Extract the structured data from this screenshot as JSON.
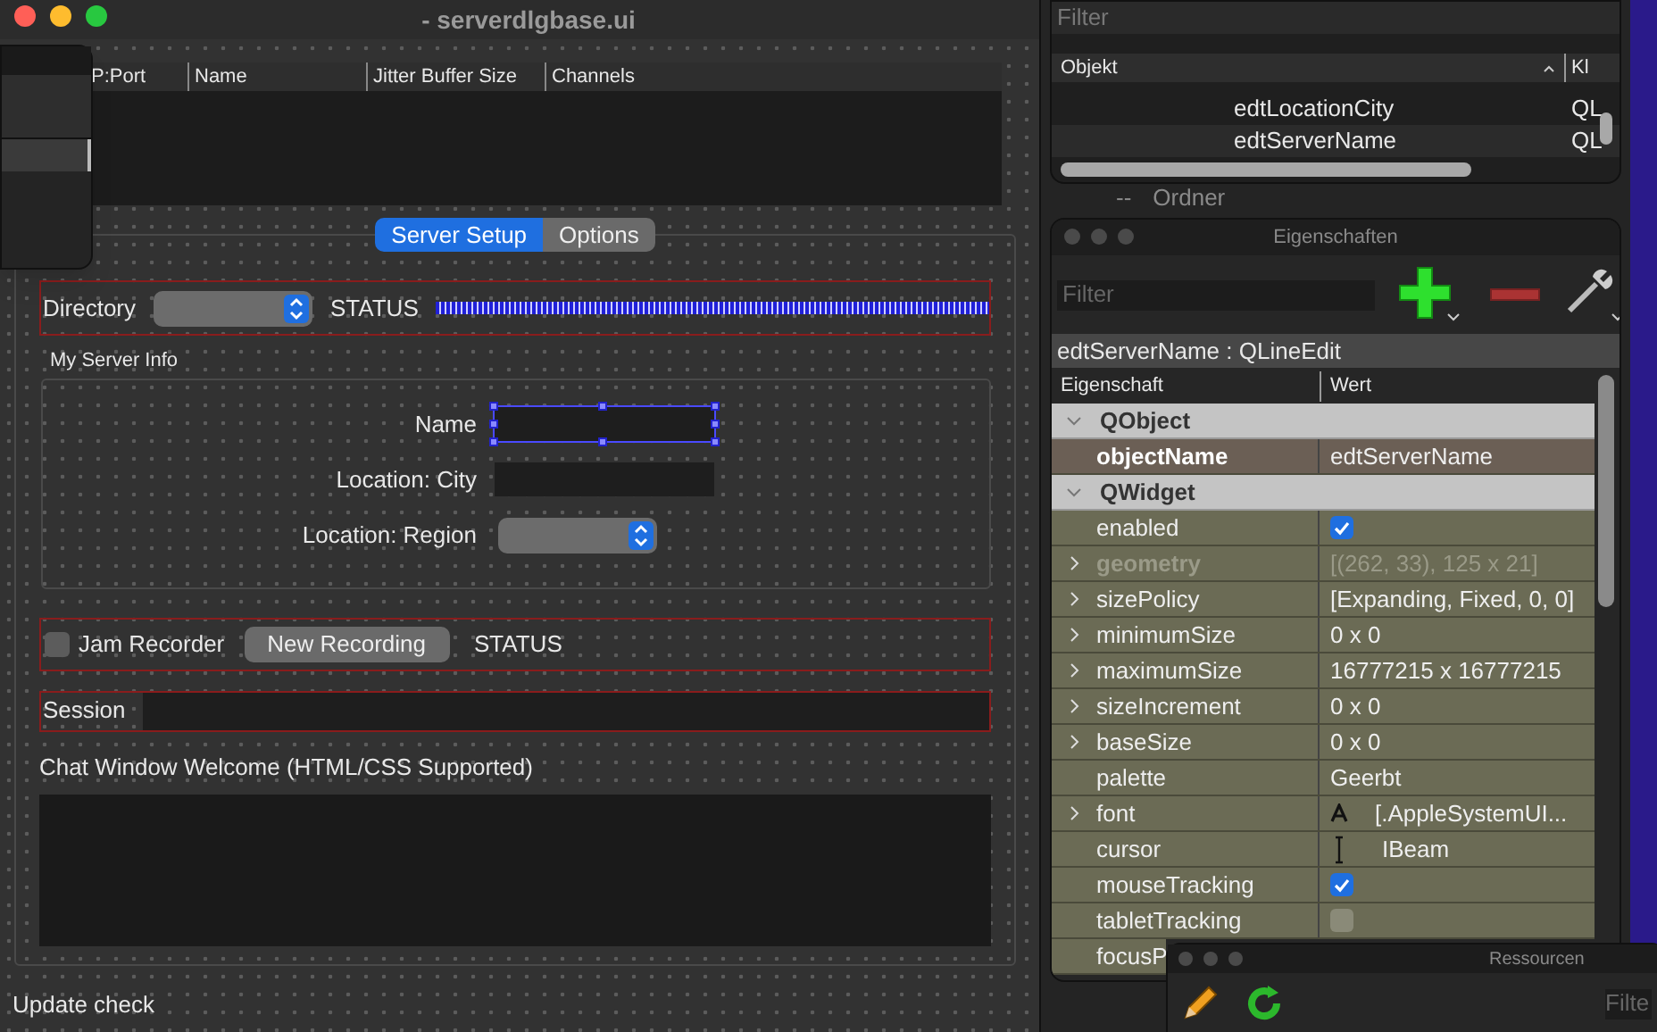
{
  "designer_window": {
    "title": "- serverdlgbase.ui",
    "server_table": {
      "columns": [
        "P:Port",
        "Name",
        "Jitter Buffer Size",
        "Channels"
      ]
    },
    "tabs": [
      {
        "label": "Server Setup",
        "selected": true
      },
      {
        "label": "Options",
        "selected": false
      }
    ],
    "directory": {
      "label": "Directory",
      "status": "STATUS"
    },
    "server_info": {
      "title": "My Server Info",
      "fields": [
        {
          "label": "Name",
          "kind": "line_edit",
          "selected": true
        },
        {
          "label": "Location: City",
          "kind": "line_edit",
          "selected": false
        },
        {
          "label": "Location: Region",
          "kind": "combo",
          "selected": false
        }
      ]
    },
    "recorder": {
      "checkbox_label": "Jam Recorder",
      "checked": false,
      "button": "New Recording",
      "status": "STATUS"
    },
    "session": {
      "label": "Session"
    },
    "welcome": {
      "label": "Chat Window Welcome (HTML/CSS Supported)"
    },
    "update_check": {
      "label": "Update check"
    }
  },
  "object_inspector": {
    "filter_placeholder": "Filter",
    "columns": [
      "Objekt",
      "Kl"
    ],
    "rows": [
      {
        "name": "edtLocationCity",
        "class": "QL"
      },
      {
        "name": "edtServerName",
        "class": "QL"
      }
    ]
  },
  "background_item": {
    "prefix": "--",
    "label": "Ordner"
  },
  "property_editor": {
    "title": "Eigenschaften",
    "filter_placeholder": "Filter",
    "object_label": "edtServerName : QLineEdit",
    "columns": [
      "Eigenschaft",
      "Wert"
    ],
    "rows": [
      {
        "kind": "group",
        "name": "QObject"
      },
      {
        "kind": "text",
        "name": "objectName",
        "value": "edtServerName",
        "expandable": false,
        "disabled": false,
        "modified": true
      },
      {
        "kind": "group",
        "name": "QWidget"
      },
      {
        "kind": "bool",
        "name": "enabled",
        "checked": true,
        "expandable": false,
        "disabled": false,
        "modified": false
      },
      {
        "kind": "text",
        "name": "geometry",
        "value": "[(262, 33), 125 x 21]",
        "expandable": true,
        "disabled": true,
        "modified": false
      },
      {
        "kind": "text",
        "name": "sizePolicy",
        "value": "[Expanding, Fixed, 0, 0]",
        "expandable": true,
        "disabled": false,
        "modified": false
      },
      {
        "kind": "text",
        "name": "minimumSize",
        "value": "0 x 0",
        "expandable": true,
        "disabled": false,
        "modified": false
      },
      {
        "kind": "text",
        "name": "maximumSize",
        "value": "16777215 x 16777215",
        "expandable": true,
        "disabled": false,
        "modified": false
      },
      {
        "kind": "text",
        "name": "sizeIncrement",
        "value": "0 x 0",
        "expandable": true,
        "disabled": false,
        "modified": false
      },
      {
        "kind": "text",
        "name": "baseSize",
        "value": "0 x 0",
        "expandable": true,
        "disabled": false,
        "modified": false
      },
      {
        "kind": "text",
        "name": "palette",
        "value": "Geerbt",
        "expandable": false,
        "disabled": false,
        "modified": false
      },
      {
        "kind": "font",
        "name": "font",
        "value": "[.AppleSystemUI...",
        "expandable": true,
        "disabled": false,
        "modified": false
      },
      {
        "kind": "cursor",
        "name": "cursor",
        "value": "IBeam",
        "expandable": false,
        "disabled": false,
        "modified": false
      },
      {
        "kind": "bool",
        "name": "mouseTracking",
        "checked": true,
        "expandable": false,
        "disabled": false,
        "modified": false
      },
      {
        "kind": "bool",
        "name": "tabletTracking",
        "checked": false,
        "expandable": false,
        "disabled": false,
        "modified": false
      },
      {
        "kind": "text",
        "name": "focusP",
        "expandable": false,
        "disabled": false,
        "modified": false
      }
    ]
  },
  "resources": {
    "title": "Ressourcen",
    "filter_placeholder": "Filte"
  }
}
